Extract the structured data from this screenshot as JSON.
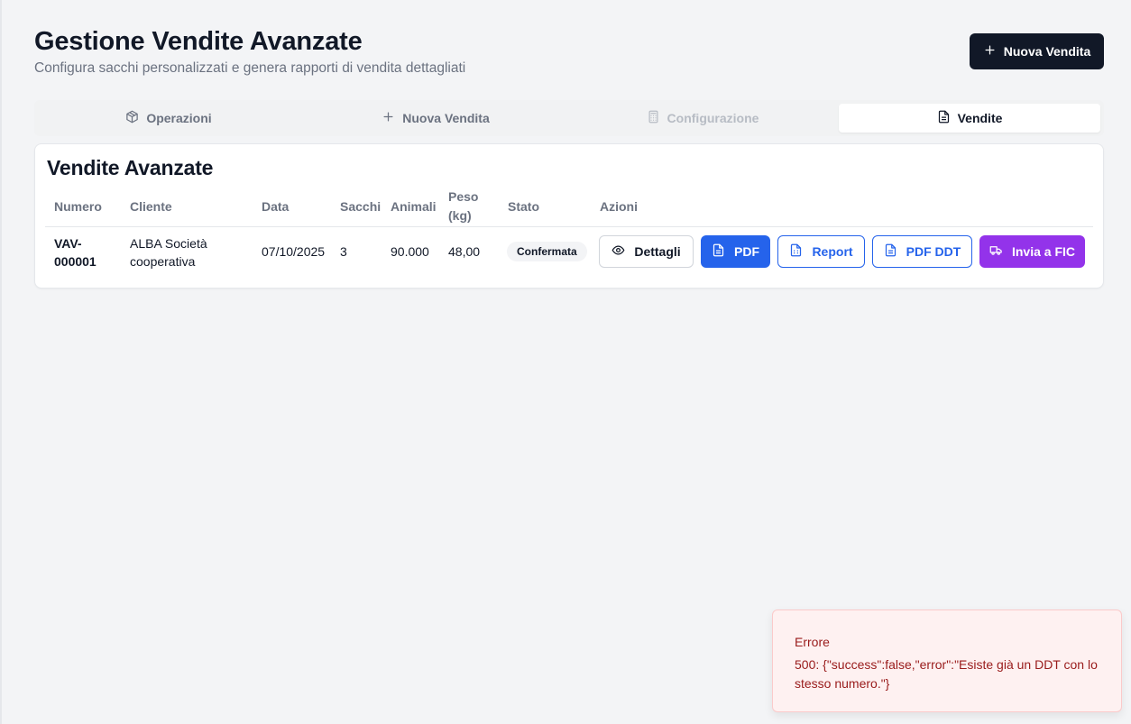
{
  "header": {
    "title": "Gestione Vendite Avanzate",
    "subtitle": "Configura sacchi personalizzati e genera rapporti di vendita dettagliati",
    "new_sale_label": "Nuova Vendita"
  },
  "tabs": [
    {
      "label": "Operazioni",
      "icon": "package-icon",
      "state": "normal"
    },
    {
      "label": "Nuova Vendita",
      "icon": "plus-icon",
      "state": "normal"
    },
    {
      "label": "Configurazione",
      "icon": "calculator-icon",
      "state": "disabled"
    },
    {
      "label": "Vendite",
      "icon": "file-text-icon",
      "state": "active"
    }
  ],
  "card": {
    "title": "Vendite Avanzate",
    "columns": {
      "numero": "Numero",
      "cliente": "Cliente",
      "data": "Data",
      "sacchi": "Sacchi",
      "animali": "Animali",
      "peso_line1": "Peso",
      "peso_line2": "(kg)",
      "stato": "Stato",
      "azioni": "Azioni"
    },
    "rows": [
      {
        "numero_line1": "VAV-",
        "numero_line2": "000001",
        "cliente_line1": "ALBA Società",
        "cliente_line2": "cooperativa",
        "data": "07/10/2025",
        "sacchi": "3",
        "animali": "90.000",
        "peso": "48,00",
        "stato": "Confermata"
      }
    ],
    "actions": {
      "details": "Dettagli",
      "pdf": "PDF",
      "report": "Report",
      "pdf_ddt": "PDF DDT",
      "send_fic": "Invia a FIC"
    }
  },
  "toast": {
    "title": "Errore",
    "message": "500: {\"success\":false,\"error\":\"Esiste già un DDT con lo stesso numero.\"}"
  },
  "colors": {
    "primary_dark": "#111827",
    "blue": "#2563eb",
    "purple": "#9333ea",
    "error_text": "#991b1b",
    "error_bg": "#fef1f1"
  }
}
